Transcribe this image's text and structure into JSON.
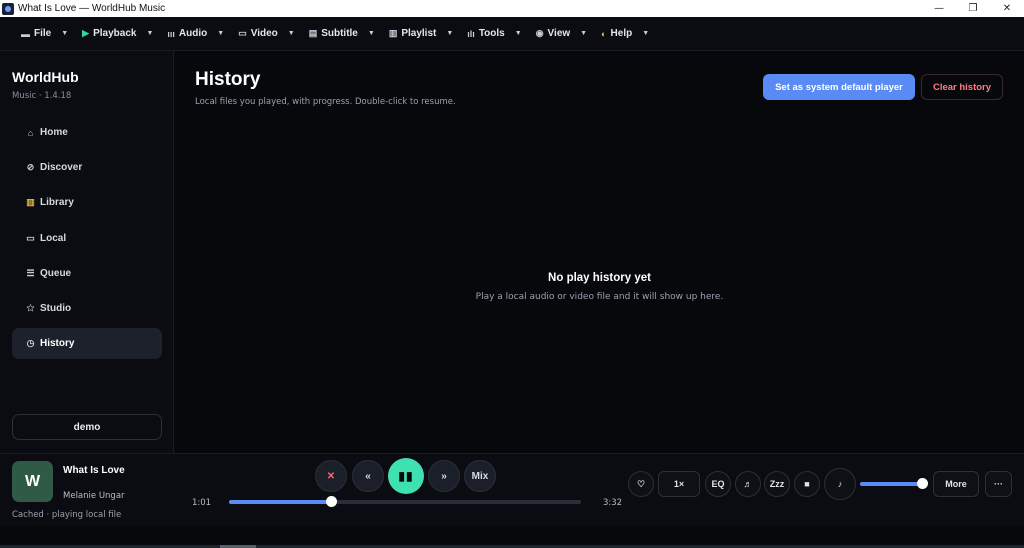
{
  "window": {
    "title": "What Is Love — WorldHub Music",
    "minimize_glyph": "—",
    "restore_glyph": "❐",
    "close_glyph": "✕"
  },
  "menu": [
    {
      "label": "File",
      "icon": "file-icon",
      "glyph": "▬"
    },
    {
      "label": "Playback",
      "icon": "play-icon",
      "glyph": "▶"
    },
    {
      "label": "Audio",
      "icon": "audio-wave-icon",
      "glyph": "ııı"
    },
    {
      "label": "Video",
      "icon": "video-icon",
      "glyph": "▭"
    },
    {
      "label": "Subtitle",
      "icon": "subtitle-icon",
      "glyph": "▤"
    },
    {
      "label": "Playlist",
      "icon": "playlist-icon",
      "glyph": "▥"
    },
    {
      "label": "Tools",
      "icon": "bars-icon",
      "glyph": "ılı"
    },
    {
      "label": "View",
      "icon": "eye-icon",
      "glyph": "◉"
    },
    {
      "label": "Help",
      "icon": "help-icon",
      "glyph": "◐"
    }
  ],
  "menu_caret": "▼",
  "sidebar": {
    "brand": "WorldHub",
    "version": "Music · 1.4.18",
    "items": [
      {
        "label": "Home",
        "icon": "home-icon",
        "glyph": "⌂"
      },
      {
        "label": "Discover",
        "icon": "compass-icon",
        "glyph": "⊘"
      },
      {
        "label": "Library",
        "icon": "library-icon",
        "glyph": "▥"
      },
      {
        "label": "Local",
        "icon": "monitor-icon",
        "glyph": "▭"
      },
      {
        "label": "Queue",
        "icon": "queue-icon",
        "glyph": "☰"
      },
      {
        "label": "Studio",
        "icon": "star-icon",
        "glyph": "✩"
      },
      {
        "label": "History",
        "icon": "clock-icon",
        "glyph": "◷"
      }
    ],
    "active_index": 6,
    "user_button": "demo"
  },
  "main": {
    "title": "History",
    "subtitle": "Local files you played, with progress. Double-click to resume.",
    "primary_button": "Set as system default player",
    "danger_button": "Clear history",
    "empty_title": "No play history yet",
    "empty_subtitle": "Play a local audio or video file and it will show up here."
  },
  "player": {
    "cover_letter": "W",
    "track_title": "What Is Love",
    "artist": "Melanie Ungar",
    "status": "Cached · playing local file",
    "controls": {
      "close": "✕",
      "rewind": "«",
      "pause": "▮▮",
      "forward": "»",
      "mix": "Mix"
    },
    "elapsed": "1:01",
    "duration": "3:32",
    "progress_fraction": 0.29,
    "right": {
      "favorite": "♡",
      "speed": "1×",
      "eq": "EQ",
      "lyrics": "♬",
      "sleep": "Zzz",
      "stop": "■",
      "volume_icon": "♪",
      "more": "More",
      "overflow": "···"
    },
    "volume_fraction": 1.0
  },
  "colors": {
    "accent": "#5a8bf5",
    "play": "#3fe0b2",
    "danger": "#ff7f7f",
    "background": "#07080c"
  }
}
